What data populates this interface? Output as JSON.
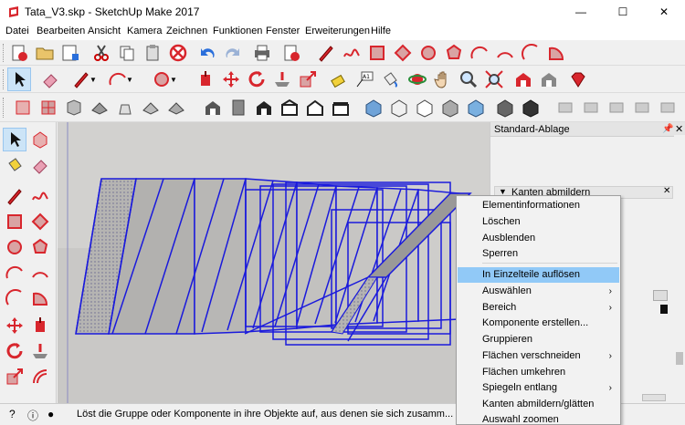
{
  "window": {
    "title": "Tata_V3.skp - SketchUp Make 2017",
    "minimize": "—",
    "maximize": "☐",
    "close": "✕"
  },
  "menu": {
    "items": [
      "Datei",
      "Bearbeiten",
      "Ansicht",
      "Kamera",
      "Zeichnen",
      "Funktionen",
      "Fenster",
      "Erweiterungen",
      "Hilfe"
    ]
  },
  "panel": {
    "tray_title": "Standard-Ablage",
    "section_title": "Kanten abmildern"
  },
  "context_menu": {
    "items": [
      {
        "label": "Elementinformationen",
        "submenu": false,
        "highlight": false
      },
      {
        "label": "Löschen",
        "submenu": false,
        "highlight": false
      },
      {
        "label": "Ausblenden",
        "submenu": false,
        "highlight": false
      },
      {
        "label": "Sperren",
        "submenu": false,
        "highlight": false
      },
      {
        "label": "In Einzelteile auflösen",
        "submenu": false,
        "highlight": true
      },
      {
        "label": "Auswählen",
        "submenu": true,
        "highlight": false
      },
      {
        "label": "Bereich",
        "submenu": true,
        "highlight": false
      },
      {
        "label": "Komponente erstellen...",
        "submenu": false,
        "highlight": false
      },
      {
        "label": "Gruppieren",
        "submenu": false,
        "highlight": false
      },
      {
        "label": "Flächen verschneiden",
        "submenu": true,
        "highlight": false
      },
      {
        "label": "Flächen umkehren",
        "submenu": false,
        "highlight": false
      },
      {
        "label": "Spiegeln entlang",
        "submenu": true,
        "highlight": false
      },
      {
        "label": "Kanten abmildern/glätten",
        "submenu": false,
        "highlight": false
      },
      {
        "label": "Auswahl zoomen",
        "submenu": false,
        "highlight": false
      }
    ]
  },
  "status": {
    "text": "Löst die Gruppe oder Komponente in ihre Objekte auf, aus denen sie sich zusamm..."
  },
  "colors": {
    "accent_highlight": "#91c9f7",
    "selection_blue": "#1a1adc"
  }
}
